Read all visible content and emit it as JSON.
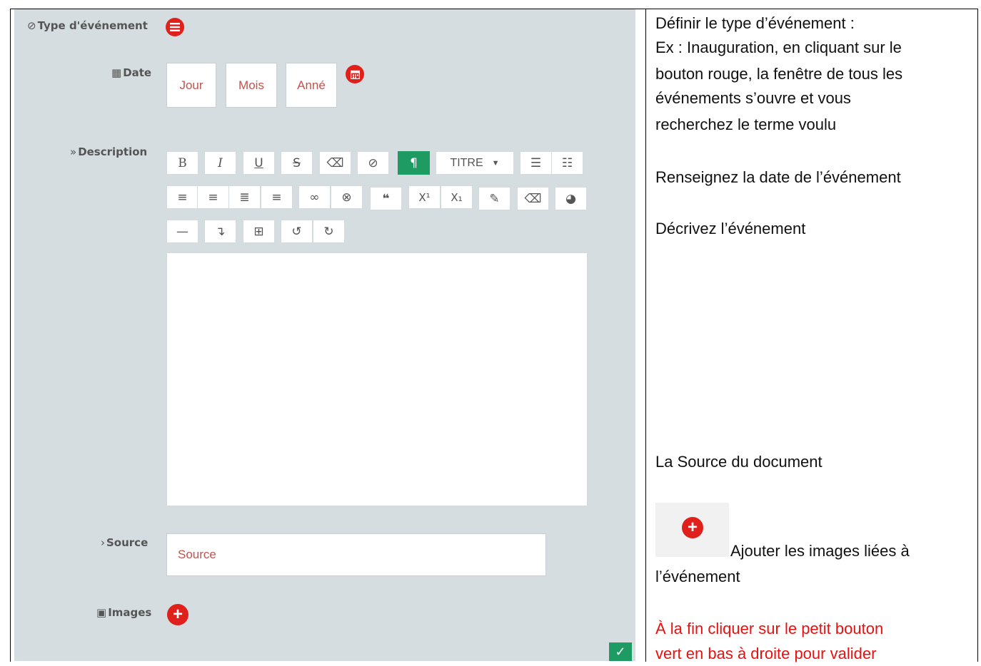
{
  "form": {
    "event_type_label": "Type d'événement",
    "date_label": "Date",
    "date_fields": [
      "Jour",
      "Mois",
      "Anné"
    ],
    "description_label": "Description",
    "toolbar": {
      "heading_label": "TITRE"
    },
    "source_label": "Source",
    "source_placeholder": "Source",
    "images_label": "Images",
    "validate_icon": "check-icon"
  },
  "instructions": {
    "type_lines": [
      "Définir le type d’événement :",
      "Ex : Inauguration, en cliquant sur le",
      "bouton rouge, la fenêtre de tous les",
      "événements s’ouvre et vous",
      "recherchez le terme voulu"
    ],
    "date_text": "Renseignez la date de l’événement",
    "description_text": "Décrivez l’événement",
    "source_text": "La Source du document",
    "images_line1": "Ajouter les images liées à",
    "images_line2": "l’événement",
    "final_line1": "À la fin cliquer sur le petit bouton",
    "final_line2": "vert en bas à droite pour valider"
  },
  "colors": {
    "accent_red": "#e0201b",
    "accent_green": "#1e9a63",
    "final_text_red": "#e8110f"
  }
}
